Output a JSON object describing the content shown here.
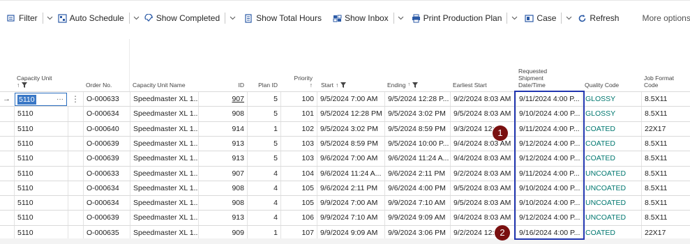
{
  "toolbar": {
    "items": [
      {
        "label": "Filter",
        "icon": "filter-icon",
        "chevron": true
      },
      {
        "label": "Auto Schedule",
        "icon": "schedule-icon",
        "chevron": true
      },
      {
        "label": "Show Completed",
        "icon": "show-completed-icon",
        "chevron": true
      },
      {
        "label": "Show Total Hours",
        "icon": "total-hours-icon",
        "chevron": false
      },
      {
        "label": "Show Inbox",
        "icon": "inbox-icon",
        "chevron": true
      },
      {
        "label": "Print Production Plan",
        "icon": "print-icon",
        "chevron": true
      },
      {
        "label": "Case",
        "icon": "case-icon",
        "chevron": true
      },
      {
        "label": "Refresh",
        "icon": "refresh-icon",
        "chevron": false
      }
    ],
    "more_options": "More options"
  },
  "columns": {
    "capacity_unit": "Capacity Unit",
    "order_no": "Order No.",
    "capacity_unit_name": "Capacity Unit Name",
    "id": "ID",
    "plan_id": "Plan ID",
    "priority": "Priority",
    "start": "Start",
    "ending": "Ending",
    "earliest_start": "Earliest Start",
    "requested_shipment_l1": "Requested",
    "requested_shipment_l2": "Shipment",
    "requested_shipment_l3": "Date/Time",
    "quality_code": "Quality Code",
    "job_format_l1": "Job Format",
    "job_format_l2": "Code"
  },
  "rows": [
    {
      "unit": "5110",
      "order": "O-000633",
      "name": "Speedmaster XL 1...",
      "id": "907",
      "plan": "5",
      "priority": "100",
      "start": "9/5/2024 7:00 AM",
      "ending": "9/5/2024 12:28 P...",
      "earliest": "9/2/2024 8:03 AM",
      "requested": "9/11/2024 4:00 P...",
      "quality": "GLOSSY",
      "format": "8.5X11"
    },
    {
      "unit": "5110",
      "order": "O-000634",
      "name": "Speedmaster XL 1...",
      "id": "908",
      "plan": "5",
      "priority": "101",
      "start": "9/5/2024 12:28 PM",
      "ending": "9/5/2024 3:02 PM",
      "earliest": "9/5/2024 8:03 AM",
      "requested": "9/10/2024 4:00 P...",
      "quality": "GLOSSY",
      "format": "8.5X11"
    },
    {
      "unit": "5110",
      "order": "O-000640",
      "name": "Speedmaster XL 1...",
      "id": "914",
      "plan": "1",
      "priority": "102",
      "start": "9/5/2024 3:02 PM",
      "ending": "9/5/2024 8:59 PM",
      "earliest": "9/3/2024 12:...",
      "requested": "9/11/2024 4:00 P...",
      "quality": "COATED",
      "format": "22X17"
    },
    {
      "unit": "5110",
      "order": "O-000639",
      "name": "Speedmaster XL 1...",
      "id": "913",
      "plan": "5",
      "priority": "103",
      "start": "9/5/2024 8:59 PM",
      "ending": "9/5/2024 10:00 P...",
      "earliest": "9/4/2024 8:03 AM",
      "requested": "9/12/2024 4:00 P...",
      "quality": "COATED",
      "format": "8.5X11"
    },
    {
      "unit": "5110",
      "order": "O-000639",
      "name": "Speedmaster XL 1...",
      "id": "913",
      "plan": "5",
      "priority": "103",
      "start": "9/6/2024 7:00 AM",
      "ending": "9/6/2024 11:24 A...",
      "earliest": "9/4/2024 8:03 AM",
      "requested": "9/12/2024 4:00 P...",
      "quality": "COATED",
      "format": "8.5X11"
    },
    {
      "unit": "5110",
      "order": "O-000633",
      "name": "Speedmaster XL 1...",
      "id": "907",
      "plan": "4",
      "priority": "104",
      "start": "9/6/2024 11:24 A...",
      "ending": "9/6/2024 2:11 PM",
      "earliest": "9/2/2024 8:03 AM",
      "requested": "9/11/2024 4:00 P...",
      "quality": "UNCOATED",
      "format": "8.5X11"
    },
    {
      "unit": "5110",
      "order": "O-000634",
      "name": "Speedmaster XL 1...",
      "id": "908",
      "plan": "4",
      "priority": "105",
      "start": "9/6/2024 2:11 PM",
      "ending": "9/6/2024 4:00 PM",
      "earliest": "9/5/2024 8:03 AM",
      "requested": "9/10/2024 4:00 P...",
      "quality": "UNCOATED",
      "format": "8.5X11"
    },
    {
      "unit": "5110",
      "order": "O-000634",
      "name": "Speedmaster XL 1...",
      "id": "908",
      "plan": "4",
      "priority": "105",
      "start": "9/9/2024 7:00 AM",
      "ending": "9/9/2024 7:10 AM",
      "earliest": "9/5/2024 8:03 AM",
      "requested": "9/10/2024 4:00 P...",
      "quality": "UNCOATED",
      "format": "8.5X11"
    },
    {
      "unit": "5110",
      "order": "O-000639",
      "name": "Speedmaster XL 1...",
      "id": "913",
      "plan": "4",
      "priority": "106",
      "start": "9/9/2024 7:10 AM",
      "ending": "9/9/2024 9:09 AM",
      "earliest": "9/4/2024 8:03 AM",
      "requested": "9/12/2024 4:00 P...",
      "quality": "UNCOATED",
      "format": "8.5X11"
    },
    {
      "unit": "5110",
      "order": "O-000635",
      "name": "Speedmaster XL 1...",
      "id": "909",
      "plan": "1",
      "priority": "107",
      "start": "9/9/2024 9:09 AM",
      "ending": "9/9/2024 3:06 PM",
      "earliest": "9/2/2024 12:...",
      "requested": "9/16/2024 4:00 P...",
      "quality": "COATED",
      "format": "22X17"
    }
  ],
  "row_marker": "→",
  "active_cell_ellipsis": "···",
  "row_menu_glyph": "⋮",
  "callouts": [
    "1",
    "2"
  ],
  "colors": {
    "link": "#00776f",
    "highlight": "#2236b0",
    "callout": "#7a1010",
    "selection": "#3a78c6"
  }
}
